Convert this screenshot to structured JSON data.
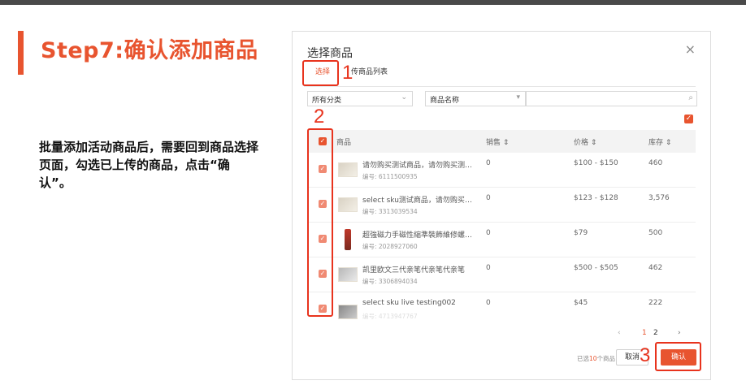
{
  "slide": {
    "title": "Step7:确认添加商品",
    "description": "批量添加活动商品后，需要回到商品选择页面，勾选已上传的商品，点击“确认”。"
  },
  "dialog": {
    "title": "选择商品",
    "close_icon": "×",
    "tabs": [
      {
        "label": "选择"
      },
      {
        "label": "传商品列表"
      }
    ],
    "filters": {
      "category": "所有分类",
      "search_field": "商品名称",
      "search_value": ""
    },
    "table": {
      "headers": {
        "product": "商品",
        "sales": "销售 ⇕",
        "price": "价格 ⇕",
        "stock": "库存 ⇕"
      },
      "rows": [
        {
          "name": "请勿购买测试商品，请勿购买测试商",
          "code": "编号: 6111500935",
          "sales": "0",
          "price": "$100 - $150",
          "stock": "460"
        },
        {
          "name": "select sku测试商品，请勿购买测...",
          "code": "编号: 3313039534",
          "sales": "0",
          "price": "$123 - $128",
          "stock": "3,576"
        },
        {
          "name": "超強磁力手磁性縮準裝飾維修螺絲...",
          "code": "编号: 2028927060",
          "sales": "0",
          "price": "$79",
          "stock": "500"
        },
        {
          "name": "凯里欧文三代亲笔代亲笔代亲笔",
          "code": "编号: 3306894034",
          "sales": "0",
          "price": "$500 - $505",
          "stock": "462"
        },
        {
          "name": "select sku live testing002",
          "code": "编号: 4713947767",
          "sales": "0",
          "price": "$45",
          "stock": "222"
        }
      ]
    },
    "pagination": {
      "prev": "‹",
      "pages": [
        "1",
        "2"
      ],
      "next": "›"
    },
    "footer": {
      "count_prefix": "已选",
      "count": "10",
      "count_suffix": "个商品",
      "cancel": "取消",
      "confirm": "确认"
    }
  },
  "annotations": {
    "n1": "1",
    "n2": "2",
    "n3": "3"
  }
}
